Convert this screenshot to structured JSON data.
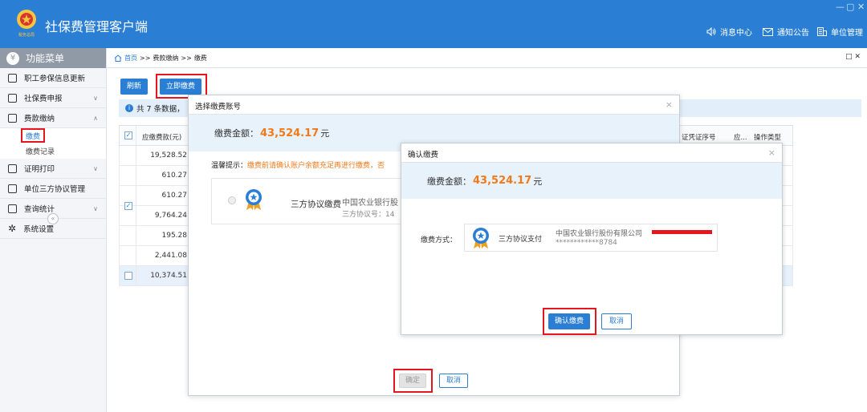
{
  "app": {
    "title": "社保费管理客户端",
    "logo_text": "税务总局",
    "window_controls": [
      "—",
      "▢",
      "✕"
    ]
  },
  "header": {
    "messages": "消息中心",
    "notices": "通知公告",
    "unit_mgmt": "单位管理"
  },
  "sidebar": {
    "title": "功能菜单",
    "items": [
      {
        "label": "职工参保信息更新",
        "icon": "list-icon"
      },
      {
        "label": "社保费申报",
        "icon": "form-icon",
        "chevron": "∨"
      },
      {
        "label": "费款缴纳",
        "icon": "bookmark-icon",
        "chevron": "∧"
      },
      {
        "label": "证明打印",
        "icon": "print-icon",
        "chevron": "∨"
      },
      {
        "label": "单位三方协议管理",
        "icon": "agreement-icon"
      },
      {
        "label": "查询统计",
        "icon": "chart-icon",
        "chevron": "∨"
      },
      {
        "label": "系统设置",
        "icon": "gear-icon"
      }
    ],
    "sub_items": [
      {
        "label": "缴费",
        "active": true
      },
      {
        "label": "缴费记录",
        "active": false
      }
    ],
    "collapse": "«"
  },
  "breadcrumb": {
    "home": "首页",
    "sep": ">>",
    "level1": "费款缴纳",
    "level2": "缴费",
    "right_icons": "□ ✕"
  },
  "toolbar": {
    "refresh": "刷新",
    "pay_now": "立即缴费"
  },
  "info": {
    "text": "共 7 条数据，"
  },
  "table": {
    "header_amount": "应缴费款(元)",
    "header_cert": "证凭证序号",
    "header_should": "应...",
    "header_optype": "操作类型",
    "rows": [
      "19,528.52",
      "610.27",
      "610.27",
      "9,764.24",
      "195.28",
      "2,441.08",
      "10,374.51"
    ]
  },
  "dialog1": {
    "title": "选择缴费账号",
    "amount_label": "缴费金额：",
    "amount_value": "43,524.17",
    "amount_unit": "元",
    "tip_label": "温馨提示：",
    "tip_text": "缴费前请确认账户余额充足再进行缴费，否",
    "method": "三方协议缴费",
    "bank": "中国农业银行股",
    "agreement_no": "三方协议号：14",
    "confirm": "确定",
    "cancel": "取消",
    "close": "×"
  },
  "dialog2": {
    "title": "确认缴费",
    "amount_label": "缴费金额：",
    "amount_value": "43,524.17",
    "amount_unit": "元",
    "method_label": "缴费方式：",
    "method": "三方协议支付",
    "bank": "中国农业银行股份有限公司",
    "account": "************8784",
    "confirm": "确认缴费",
    "cancel": "取消",
    "close": "×"
  },
  "colors": {
    "brand_blue": "#2a7fd4",
    "highlight_red": "#e6161e",
    "amount_orange": "#f07a1a"
  }
}
